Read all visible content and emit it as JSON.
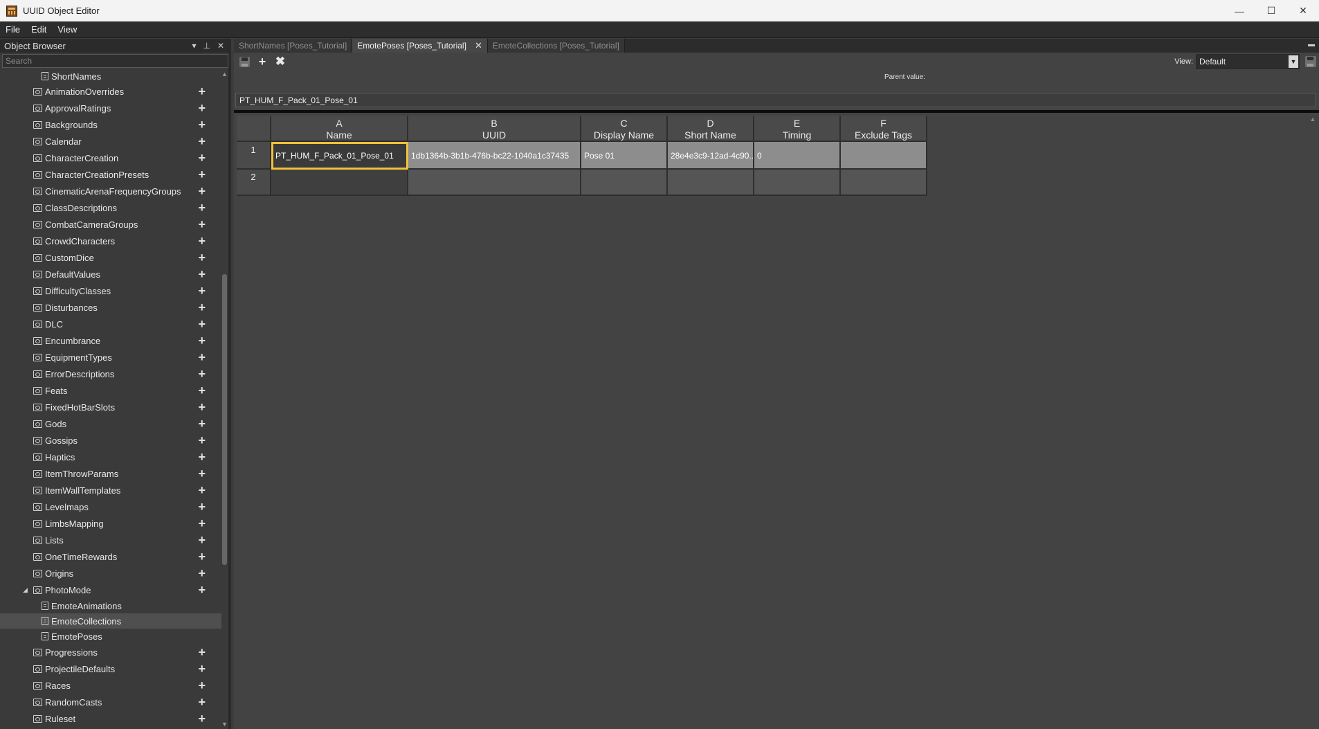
{
  "window": {
    "title": "UUID Object Editor",
    "controls": [
      "—",
      "☐",
      "✕"
    ]
  },
  "menu": [
    "File",
    "Edit",
    "View"
  ],
  "object_browser": {
    "title": "Object Browser",
    "search_placeholder": "Search",
    "items": [
      {
        "label": "ShortNames",
        "type": "file",
        "level": 2,
        "plus": false,
        "selected": false
      },
      {
        "label": "AnimationOverrides",
        "type": "folder",
        "level": 1,
        "plus": true,
        "selected": false
      },
      {
        "label": "ApprovalRatings",
        "type": "folder",
        "level": 1,
        "plus": true,
        "selected": false
      },
      {
        "label": "Backgrounds",
        "type": "folder",
        "level": 1,
        "plus": true,
        "selected": false
      },
      {
        "label": "Calendar",
        "type": "folder",
        "level": 1,
        "plus": true,
        "selected": false
      },
      {
        "label": "CharacterCreation",
        "type": "folder",
        "level": 1,
        "plus": true,
        "selected": false
      },
      {
        "label": "CharacterCreationPresets",
        "type": "folder",
        "level": 1,
        "plus": true,
        "selected": false
      },
      {
        "label": "CinematicArenaFrequencyGroups",
        "type": "folder",
        "level": 1,
        "plus": true,
        "selected": false
      },
      {
        "label": "ClassDescriptions",
        "type": "folder",
        "level": 1,
        "plus": true,
        "selected": false
      },
      {
        "label": "CombatCameraGroups",
        "type": "folder",
        "level": 1,
        "plus": true,
        "selected": false
      },
      {
        "label": "CrowdCharacters",
        "type": "folder",
        "level": 1,
        "plus": true,
        "selected": false
      },
      {
        "label": "CustomDice",
        "type": "folder",
        "level": 1,
        "plus": true,
        "selected": false
      },
      {
        "label": "DefaultValues",
        "type": "folder",
        "level": 1,
        "plus": true,
        "selected": false
      },
      {
        "label": "DifficultyClasses",
        "type": "folder",
        "level": 1,
        "plus": true,
        "selected": false
      },
      {
        "label": "Disturbances",
        "type": "folder",
        "level": 1,
        "plus": true,
        "selected": false
      },
      {
        "label": "DLC",
        "type": "folder",
        "level": 1,
        "plus": true,
        "selected": false
      },
      {
        "label": "Encumbrance",
        "type": "folder",
        "level": 1,
        "plus": true,
        "selected": false
      },
      {
        "label": "EquipmentTypes",
        "type": "folder",
        "level": 1,
        "plus": true,
        "selected": false
      },
      {
        "label": "ErrorDescriptions",
        "type": "folder",
        "level": 1,
        "plus": true,
        "selected": false
      },
      {
        "label": "Feats",
        "type": "folder",
        "level": 1,
        "plus": true,
        "selected": false
      },
      {
        "label": "FixedHotBarSlots",
        "type": "folder",
        "level": 1,
        "plus": true,
        "selected": false
      },
      {
        "label": "Gods",
        "type": "folder",
        "level": 1,
        "plus": true,
        "selected": false
      },
      {
        "label": "Gossips",
        "type": "folder",
        "level": 1,
        "plus": true,
        "selected": false
      },
      {
        "label": "Haptics",
        "type": "folder",
        "level": 1,
        "plus": true,
        "selected": false
      },
      {
        "label": "ItemThrowParams",
        "type": "folder",
        "level": 1,
        "plus": true,
        "selected": false
      },
      {
        "label": "ItemWallTemplates",
        "type": "folder",
        "level": 1,
        "plus": true,
        "selected": false
      },
      {
        "label": "Levelmaps",
        "type": "folder",
        "level": 1,
        "plus": true,
        "selected": false
      },
      {
        "label": "LimbsMapping",
        "type": "folder",
        "level": 1,
        "plus": true,
        "selected": false
      },
      {
        "label": "Lists",
        "type": "folder",
        "level": 1,
        "plus": true,
        "selected": false
      },
      {
        "label": "OneTimeRewards",
        "type": "folder",
        "level": 1,
        "plus": true,
        "selected": false
      },
      {
        "label": "Origins",
        "type": "folder",
        "level": 1,
        "plus": true,
        "selected": false
      },
      {
        "label": "PhotoMode",
        "type": "folder",
        "level": 1,
        "plus": true,
        "selected": false,
        "expanded": true
      },
      {
        "label": "EmoteAnimations",
        "type": "file",
        "level": 2,
        "plus": false,
        "selected": false
      },
      {
        "label": "EmoteCollections",
        "type": "file",
        "level": 2,
        "plus": false,
        "selected": true
      },
      {
        "label": "EmotePoses",
        "type": "file",
        "level": 2,
        "plus": false,
        "selected": false
      },
      {
        "label": "Progressions",
        "type": "folder",
        "level": 1,
        "plus": true,
        "selected": false
      },
      {
        "label": "ProjectileDefaults",
        "type": "folder",
        "level": 1,
        "plus": true,
        "selected": false
      },
      {
        "label": "Races",
        "type": "folder",
        "level": 1,
        "plus": true,
        "selected": false
      },
      {
        "label": "RandomCasts",
        "type": "folder",
        "level": 1,
        "plus": true,
        "selected": false
      },
      {
        "label": "Ruleset",
        "type": "folder",
        "level": 1,
        "plus": true,
        "selected": false
      }
    ]
  },
  "tabs": [
    {
      "label": "ShortNames [Poses_Tutorial]",
      "active": false
    },
    {
      "label": "EmotePoses [Poses_Tutorial]",
      "active": true
    },
    {
      "label": "EmoteCollections [Poses_Tutorial]",
      "active": false
    }
  ],
  "toolbar": {
    "view_label": "View:",
    "view_value": "Default",
    "parent_label": "Parent value:"
  },
  "current_value": "PT_HUM_F_Pack_01_Pose_01",
  "grid": {
    "columns": [
      {
        "letter": "A",
        "name": "Name"
      },
      {
        "letter": "B",
        "name": "UUID"
      },
      {
        "letter": "C",
        "name": "Display Name"
      },
      {
        "letter": "D",
        "name": "Short Name"
      },
      {
        "letter": "E",
        "name": "Timing"
      },
      {
        "letter": "F",
        "name": "Exclude Tags"
      }
    ],
    "rows": [
      {
        "num": "1",
        "cells": [
          "PT_HUM_F_Pack_01_Pose_01",
          "1db1364b-3b1b-476b-bc22-1040a1c37435",
          "Pose 01",
          "28e4e3c9-12ad-4c90...",
          "0",
          ""
        ]
      },
      {
        "num": "2",
        "cells": [
          "",
          "",
          "",
          "",
          "",
          ""
        ]
      }
    ]
  }
}
